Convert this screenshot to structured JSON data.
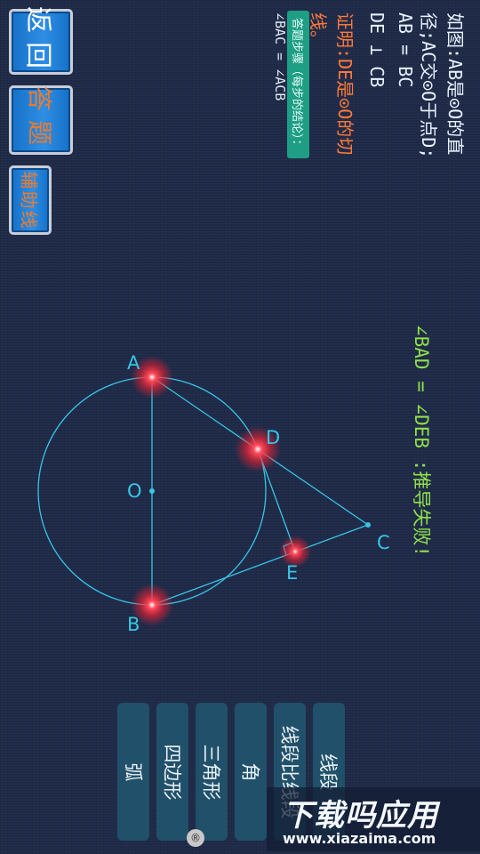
{
  "menu": {
    "back_label": "返回",
    "answer_label": "答题",
    "aux_label": "辅助线"
  },
  "problem": {
    "line1": "如图:AB是⊙O的直",
    "line2": "径;AC交⊙O于点D;",
    "line3": "AB = BC",
    "line4": "DE ⊥ CB",
    "prove_line1": "证明:DE是⊙O的切",
    "prove_line2": "线。"
  },
  "answer": {
    "chip_label": "答题步骤（每步的结论）：",
    "step1": "∠BAC = ∠ACB"
  },
  "feedback": {
    "message": "∠BAD = ∠DEB :推导失败!"
  },
  "figure": {
    "point_labels": {
      "A": "A",
      "B": "B",
      "C": "C",
      "D": "D",
      "E": "E",
      "O": "O"
    },
    "line_color": "#36c6e6",
    "highlight_color": "#ff2a3a"
  },
  "tools": {
    "segment": "线段",
    "segment_ratio": "线段比线段",
    "angle": "角",
    "triangle": "三角形",
    "quadrilateral": "四边形",
    "arc": "弧"
  },
  "watermark": {
    "title": "下载吗应用",
    "url": "www.xiazaima.com",
    "badge": "®"
  }
}
